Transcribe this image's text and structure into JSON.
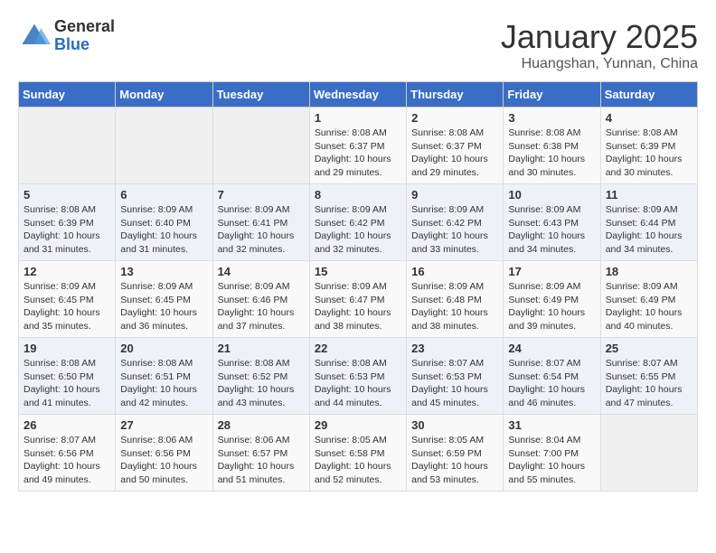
{
  "header": {
    "logo_general": "General",
    "logo_blue": "Blue",
    "title": "January 2025",
    "subtitle": "Huangshan, Yunnan, China"
  },
  "weekdays": [
    "Sunday",
    "Monday",
    "Tuesday",
    "Wednesday",
    "Thursday",
    "Friday",
    "Saturday"
  ],
  "weeks": [
    [
      {
        "num": "",
        "info": ""
      },
      {
        "num": "",
        "info": ""
      },
      {
        "num": "",
        "info": ""
      },
      {
        "num": "1",
        "info": "Sunrise: 8:08 AM\nSunset: 6:37 PM\nDaylight: 10 hours\nand 29 minutes."
      },
      {
        "num": "2",
        "info": "Sunrise: 8:08 AM\nSunset: 6:37 PM\nDaylight: 10 hours\nand 29 minutes."
      },
      {
        "num": "3",
        "info": "Sunrise: 8:08 AM\nSunset: 6:38 PM\nDaylight: 10 hours\nand 30 minutes."
      },
      {
        "num": "4",
        "info": "Sunrise: 8:08 AM\nSunset: 6:39 PM\nDaylight: 10 hours\nand 30 minutes."
      }
    ],
    [
      {
        "num": "5",
        "info": "Sunrise: 8:08 AM\nSunset: 6:39 PM\nDaylight: 10 hours\nand 31 minutes."
      },
      {
        "num": "6",
        "info": "Sunrise: 8:09 AM\nSunset: 6:40 PM\nDaylight: 10 hours\nand 31 minutes."
      },
      {
        "num": "7",
        "info": "Sunrise: 8:09 AM\nSunset: 6:41 PM\nDaylight: 10 hours\nand 32 minutes."
      },
      {
        "num": "8",
        "info": "Sunrise: 8:09 AM\nSunset: 6:42 PM\nDaylight: 10 hours\nand 32 minutes."
      },
      {
        "num": "9",
        "info": "Sunrise: 8:09 AM\nSunset: 6:42 PM\nDaylight: 10 hours\nand 33 minutes."
      },
      {
        "num": "10",
        "info": "Sunrise: 8:09 AM\nSunset: 6:43 PM\nDaylight: 10 hours\nand 34 minutes."
      },
      {
        "num": "11",
        "info": "Sunrise: 8:09 AM\nSunset: 6:44 PM\nDaylight: 10 hours\nand 34 minutes."
      }
    ],
    [
      {
        "num": "12",
        "info": "Sunrise: 8:09 AM\nSunset: 6:45 PM\nDaylight: 10 hours\nand 35 minutes."
      },
      {
        "num": "13",
        "info": "Sunrise: 8:09 AM\nSunset: 6:45 PM\nDaylight: 10 hours\nand 36 minutes."
      },
      {
        "num": "14",
        "info": "Sunrise: 8:09 AM\nSunset: 6:46 PM\nDaylight: 10 hours\nand 37 minutes."
      },
      {
        "num": "15",
        "info": "Sunrise: 8:09 AM\nSunset: 6:47 PM\nDaylight: 10 hours\nand 38 minutes."
      },
      {
        "num": "16",
        "info": "Sunrise: 8:09 AM\nSunset: 6:48 PM\nDaylight: 10 hours\nand 38 minutes."
      },
      {
        "num": "17",
        "info": "Sunrise: 8:09 AM\nSunset: 6:49 PM\nDaylight: 10 hours\nand 39 minutes."
      },
      {
        "num": "18",
        "info": "Sunrise: 8:09 AM\nSunset: 6:49 PM\nDaylight: 10 hours\nand 40 minutes."
      }
    ],
    [
      {
        "num": "19",
        "info": "Sunrise: 8:08 AM\nSunset: 6:50 PM\nDaylight: 10 hours\nand 41 minutes."
      },
      {
        "num": "20",
        "info": "Sunrise: 8:08 AM\nSunset: 6:51 PM\nDaylight: 10 hours\nand 42 minutes."
      },
      {
        "num": "21",
        "info": "Sunrise: 8:08 AM\nSunset: 6:52 PM\nDaylight: 10 hours\nand 43 minutes."
      },
      {
        "num": "22",
        "info": "Sunrise: 8:08 AM\nSunset: 6:53 PM\nDaylight: 10 hours\nand 44 minutes."
      },
      {
        "num": "23",
        "info": "Sunrise: 8:07 AM\nSunset: 6:53 PM\nDaylight: 10 hours\nand 45 minutes."
      },
      {
        "num": "24",
        "info": "Sunrise: 8:07 AM\nSunset: 6:54 PM\nDaylight: 10 hours\nand 46 minutes."
      },
      {
        "num": "25",
        "info": "Sunrise: 8:07 AM\nSunset: 6:55 PM\nDaylight: 10 hours\nand 47 minutes."
      }
    ],
    [
      {
        "num": "26",
        "info": "Sunrise: 8:07 AM\nSunset: 6:56 PM\nDaylight: 10 hours\nand 49 minutes."
      },
      {
        "num": "27",
        "info": "Sunrise: 8:06 AM\nSunset: 6:56 PM\nDaylight: 10 hours\nand 50 minutes."
      },
      {
        "num": "28",
        "info": "Sunrise: 8:06 AM\nSunset: 6:57 PM\nDaylight: 10 hours\nand 51 minutes."
      },
      {
        "num": "29",
        "info": "Sunrise: 8:05 AM\nSunset: 6:58 PM\nDaylight: 10 hours\nand 52 minutes."
      },
      {
        "num": "30",
        "info": "Sunrise: 8:05 AM\nSunset: 6:59 PM\nDaylight: 10 hours\nand 53 minutes."
      },
      {
        "num": "31",
        "info": "Sunrise: 8:04 AM\nSunset: 7:00 PM\nDaylight: 10 hours\nand 55 minutes."
      },
      {
        "num": "",
        "info": ""
      }
    ]
  ]
}
